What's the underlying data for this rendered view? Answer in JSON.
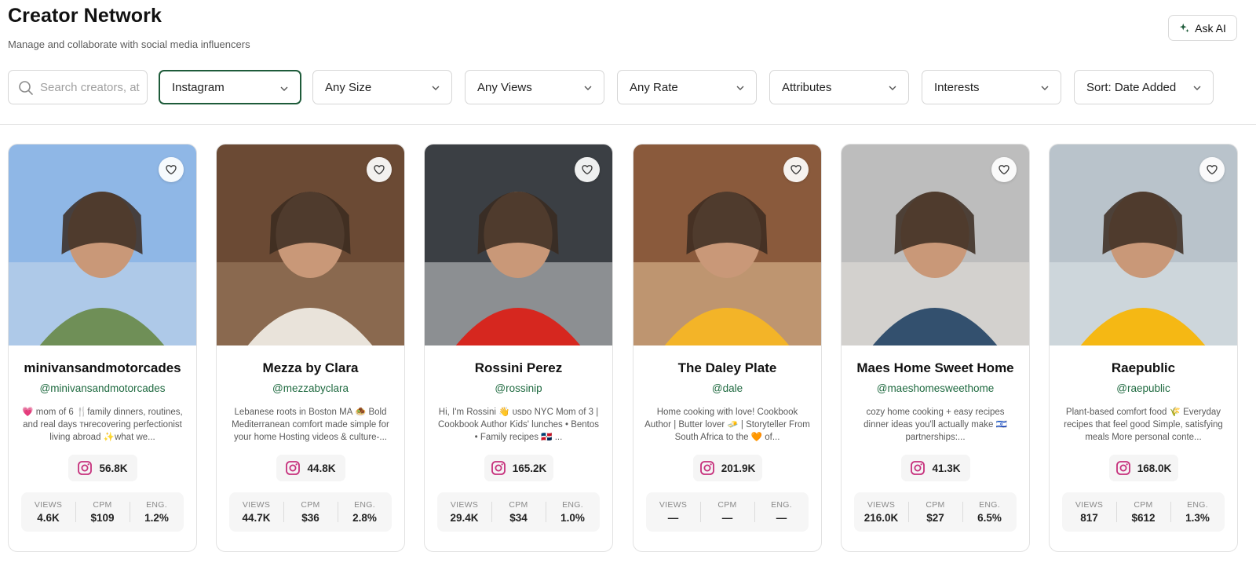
{
  "page": {
    "title": "Creator Network",
    "subtitle": "Manage and collaborate with social media influencers",
    "ask_ai_label": "Ask AI"
  },
  "filters": {
    "search_placeholder": "Search creators, at",
    "platform": "Instagram",
    "size": "Any Size",
    "views": "Any Views",
    "rate": "Any Rate",
    "attributes": "Attributes",
    "interests": "Interests",
    "sort": "Sort: Date Added"
  },
  "stat_labels": {
    "views": "VIEWS",
    "cpm": "CPM",
    "eng": "ENG."
  },
  "creators": [
    {
      "name": "minivansandmotorcades",
      "handle": "@minivansandmotorcades",
      "bio": "💗 mom of 6 🍴family dinners, routines, and real days ᴛʜrecovering perfectionist living abroad ✨what we...",
      "followers": "56.8K",
      "views": "4.6K",
      "cpm": "$109",
      "eng": "1.2%"
    },
    {
      "name": "Mezza by Clara",
      "handle": "@mezzabyclara",
      "bio": "Lebanese roots in Boston MA 🧆 Bold Mediterranean comfort made simple for your home Hosting videos & culture-...",
      "followers": "44.8K",
      "views": "44.7K",
      "cpm": "$36",
      "eng": "2.8%"
    },
    {
      "name": "Rossini Perez",
      "handle": "@rossinip",
      "bio": "Hi, I'm Rossini 👋 ᴜsᴅᴏ NYC Mom of 3 | Cookbook Author Kids' lunches • Bentos • Family recipes 🇩🇴 ...",
      "followers": "165.2K",
      "views": "29.4K",
      "cpm": "$34",
      "eng": "1.0%"
    },
    {
      "name": "The Daley Plate",
      "handle": "@dale",
      "bio": "Home cooking with love! Cookbook Author | Butter lover 🧈 | Storyteller From South Africa to the 🧡 of...",
      "followers": "201.9K",
      "views": "—",
      "cpm": "—",
      "eng": "—"
    },
    {
      "name": "Maes Home Sweet Home",
      "handle": "@maeshomesweethome",
      "bio": "cozy home cooking + easy recipes dinner ideas you'll actually make 🇮🇱 partnerships:...",
      "followers": "41.3K",
      "views": "216.0K",
      "cpm": "$27",
      "eng": "6.5%"
    },
    {
      "name": "Raepublic",
      "handle": "@raepublic",
      "bio": "Plant-based comfort food 🌾 Everyday recipes that feel good Simple, satisfying meals More personal conte...",
      "followers": "168.0K",
      "views": "817",
      "cpm": "$612",
      "eng": "1.3%"
    }
  ]
}
